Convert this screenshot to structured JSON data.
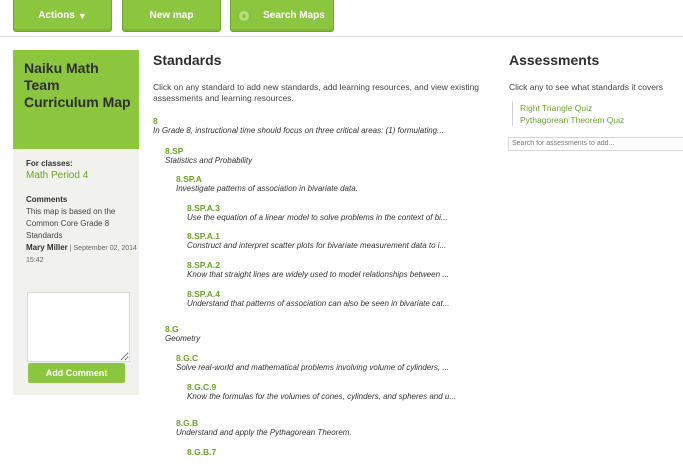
{
  "tabs": {
    "actions": "Actions",
    "new_map": "New map",
    "search_maps": "Search Maps"
  },
  "sidebar": {
    "title": "Naiku Math Team Curriculum Map",
    "for_classes_label": "For classes:",
    "class_name": "Math Period 4",
    "comments_label": "Comments",
    "comment_text": "This map is based on the Common Core Grade 8 Standards",
    "comment_author": "Mary Miller",
    "comment_date": "September 02, 2014 15:42",
    "add_comment_label": "Add Comment"
  },
  "standards": {
    "heading": "Standards",
    "intro": "Click on any standard to add new standards, add learning resources, and view existing assessments and learning resources.",
    "items": [
      {
        "code": "8",
        "desc": "In Grade 8, instructional time should focus on three critical areas: (1) formulating..."
      },
      {
        "code": "8.SP",
        "desc": "Statistics and Probability"
      },
      {
        "code": "8.SP.A",
        "desc": "Investigate patterns of association in bivariate data."
      },
      {
        "code": "8.SP.A.3",
        "desc": "Use the equation of a linear model to solve problems in the context of bi..."
      },
      {
        "code": "8.SP.A.1",
        "desc": "Construct and interpret scatter plots for bivariate measurement data to i..."
      },
      {
        "code": "8.SP.A.2",
        "desc": "Know that straight lines are widely used to model relationships between ..."
      },
      {
        "code": "8.SP.A.4",
        "desc": "Understand that patterns of association can also be seen in bivariate cat..."
      },
      {
        "code": "8.G",
        "desc": "Geometry"
      },
      {
        "code": "8.G.C",
        "desc": "Solve real-world and mathematical problems involving volume of cylinders, ..."
      },
      {
        "code": "8.G.C.9",
        "desc": "Know the formulas for the volumes of cones, cylinders, and spheres and u..."
      },
      {
        "code": "8.G.B",
        "desc": "Understand and apply the Pythagorean Theorem."
      },
      {
        "code": "8.G.B.7",
        "desc": ""
      }
    ]
  },
  "assessments": {
    "heading": "Assessments",
    "intro": "Click any to see what standards it covers",
    "items": [
      "Right Triangle Quiz",
      "Pythagorean Theorem Quiz"
    ],
    "search_placeholder": "Search for assessments to add..."
  },
  "colors": {
    "brand_green": "#8cc63f",
    "link_green": "#6aa329",
    "sidebar_bg": "#f1f1ee"
  },
  "icons": {
    "actions_dropdown": "caret-down-icon",
    "search_maps": "search-icon"
  }
}
